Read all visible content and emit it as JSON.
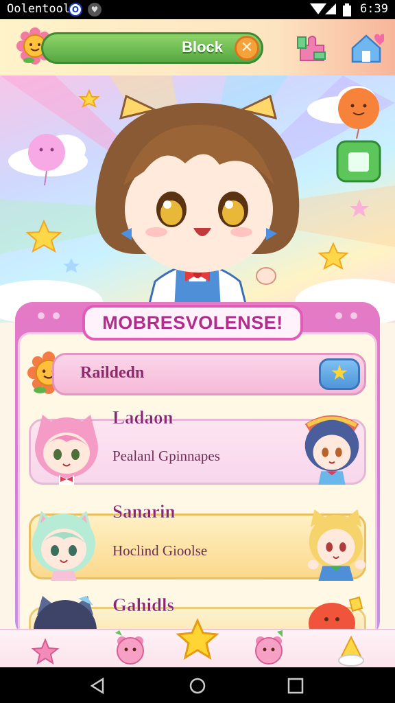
{
  "status_bar": {
    "app_name": "Oolentool",
    "time": "6:39"
  },
  "top_bar": {
    "search_label": "Block",
    "close_glyph": "✕"
  },
  "panel": {
    "title": "MOBRESVOLENSE!",
    "filter_label": "Raildedn",
    "characters": [
      {
        "name": "Ladaon",
        "subtitle": "Pealanl Gpinnapes"
      },
      {
        "name": "Sanarin",
        "subtitle": "Hoclind Gioolse"
      },
      {
        "name": "Gahidls",
        "subtitle": ""
      }
    ]
  },
  "icons": {
    "top_left": "sun-flower-icon",
    "top_right_1": "puzzle-icon",
    "top_right_2": "house-heart-icon",
    "filter_left": "sun-flower-icon",
    "filter_star": "star-icon",
    "tabs": [
      "pink-star-icon",
      "pink-bear-icon",
      "gold-star-icon",
      "pink-bear-icon",
      "party-hat-icon"
    ]
  },
  "colors": {
    "accent_pink": "#e25bb6",
    "green": "#56a841",
    "gold": "#ffd633",
    "blue": "#4f95d8"
  }
}
